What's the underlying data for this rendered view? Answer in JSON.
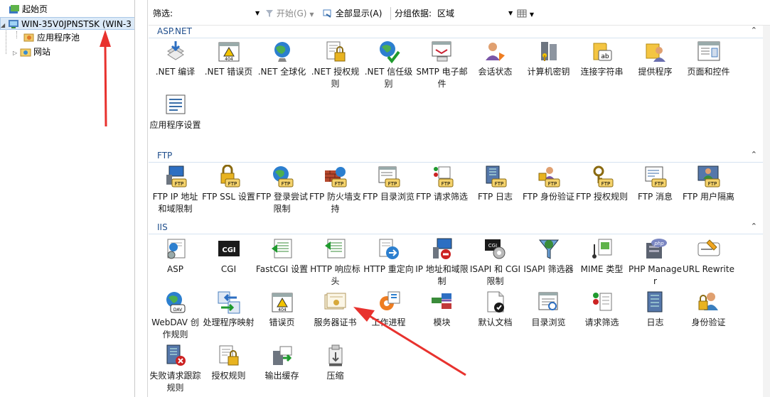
{
  "tree": {
    "start_page": "起始页",
    "server": "WIN-35V0JPNSTSK (WIN-3",
    "app_pools": "应用程序池",
    "sites": "网站"
  },
  "toolbar": {
    "filter_label": "筛选:",
    "start_label": "开始(G)",
    "show_all_label": "全部显示(A)",
    "group_label": "分组依据:",
    "group_value": "区域"
  },
  "sections": {
    "aspnet": "ASP.NET",
    "ftp": "FTP",
    "iis": "IIS"
  },
  "aspnet_items": [
    {
      "label": ".NET 编译",
      "icon": "net-compile-icon"
    },
    {
      "label": ".NET 错误页",
      "icon": "net-error-page-icon"
    },
    {
      "label": ".NET 全球化",
      "icon": "net-globalization-icon"
    },
    {
      "label": ".NET 授权规则",
      "icon": "net-authorization-icon"
    },
    {
      "label": ".NET 信任级别",
      "icon": "net-trust-icon"
    },
    {
      "label": "SMTP 电子邮件",
      "icon": "smtp-email-icon"
    },
    {
      "label": "会话状态",
      "icon": "session-state-icon"
    },
    {
      "label": "计算机密钥",
      "icon": "machine-key-icon"
    },
    {
      "label": "连接字符串",
      "icon": "connection-strings-icon"
    },
    {
      "label": "提供程序",
      "icon": "providers-icon"
    },
    {
      "label": "页面和控件",
      "icon": "pages-controls-icon"
    },
    {
      "label": "应用程序设置",
      "icon": "app-settings-icon"
    }
  ],
  "ftp_items": [
    {
      "label": "FTP IP 地址和域限制",
      "icon": "ftp-ip-restrict-icon"
    },
    {
      "label": "FTP SSL 设置",
      "icon": "ftp-ssl-icon"
    },
    {
      "label": "FTP 登录尝试限制",
      "icon": "ftp-logon-attempt-icon"
    },
    {
      "label": "FTP 防火墙支持",
      "icon": "ftp-firewall-icon"
    },
    {
      "label": "FTP 目录浏览",
      "icon": "ftp-directory-browsing-icon"
    },
    {
      "label": "FTP 请求筛选",
      "icon": "ftp-request-filter-icon"
    },
    {
      "label": "FTP 日志",
      "icon": "ftp-logging-icon"
    },
    {
      "label": "FTP 身份验证",
      "icon": "ftp-authentication-icon"
    },
    {
      "label": "FTP 授权规则",
      "icon": "ftp-authorization-icon"
    },
    {
      "label": "FTP 消息",
      "icon": "ftp-messages-icon"
    },
    {
      "label": "FTP 用户隔离",
      "icon": "ftp-user-isolation-icon"
    }
  ],
  "iis_items": [
    {
      "label": "ASP",
      "icon": "asp-icon"
    },
    {
      "label": "CGI",
      "icon": "cgi-icon"
    },
    {
      "label": "FastCGI 设置",
      "icon": "fastcgi-icon"
    },
    {
      "label": "HTTP 响应标头",
      "icon": "http-headers-icon"
    },
    {
      "label": "HTTP 重定向",
      "icon": "http-redirect-icon"
    },
    {
      "label": "IP 地址和域限制",
      "icon": "ip-restrict-icon"
    },
    {
      "label": "ISAPI 和 CGI 限制",
      "icon": "isapi-cgi-icon"
    },
    {
      "label": "ISAPI 筛选器",
      "icon": "isapi-filters-icon"
    },
    {
      "label": "MIME 类型",
      "icon": "mime-types-icon"
    },
    {
      "label": "PHP Manager",
      "icon": "php-manager-icon"
    },
    {
      "label": "URL Rewrite",
      "icon": "url-rewrite-icon"
    },
    {
      "label": "WebDAV 创作规则",
      "icon": "webdav-icon"
    },
    {
      "label": "处理程序映射",
      "icon": "handler-mappings-icon"
    },
    {
      "label": "错误页",
      "icon": "error-pages-icon"
    },
    {
      "label": "服务器证书",
      "icon": "server-certificates-icon"
    },
    {
      "label": "工作进程",
      "icon": "worker-processes-icon"
    },
    {
      "label": "模块",
      "icon": "modules-icon"
    },
    {
      "label": "默认文档",
      "icon": "default-document-icon"
    },
    {
      "label": "目录浏览",
      "icon": "directory-browsing-icon"
    },
    {
      "label": "请求筛选",
      "icon": "request-filtering-icon"
    },
    {
      "label": "日志",
      "icon": "logging-icon"
    },
    {
      "label": "身份验证",
      "icon": "authentication-icon"
    },
    {
      "label": "失败请求跟踪规则",
      "icon": "failed-request-tracing-icon"
    },
    {
      "label": "授权规则",
      "icon": "authorization-rules-icon"
    },
    {
      "label": "输出缓存",
      "icon": "output-caching-icon"
    },
    {
      "label": "压缩",
      "icon": "compression-icon"
    }
  ]
}
